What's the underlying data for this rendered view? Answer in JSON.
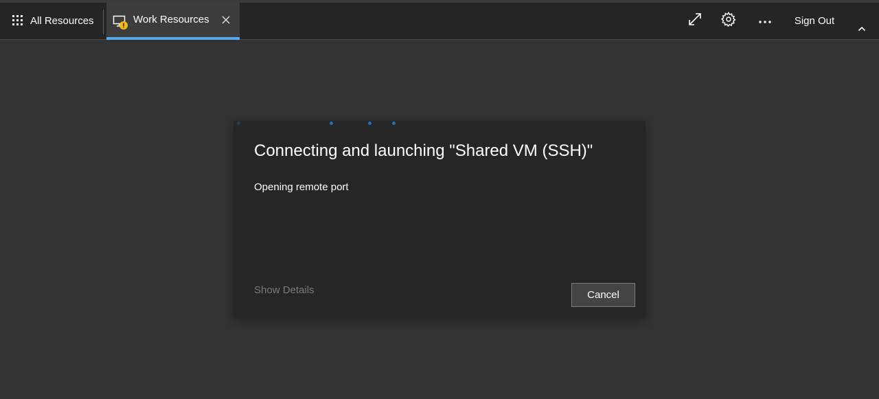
{
  "header": {
    "all_resources_label": "All Resources",
    "all_resources_icon": "apps-grid-icon",
    "tab": {
      "label": "Work Resources",
      "icon": "remote-desktop-warning-icon",
      "badge_icon": "warning-badge-icon",
      "close_icon": "close-icon",
      "accent_color": "#5aa9e6"
    },
    "actions": {
      "fullscreen_icon": "expand-icon",
      "settings_icon": "gear-icon",
      "more_icon": "more-dots-icon",
      "sign_out_label": "Sign Out",
      "collapse_icon": "chevron-up-icon"
    }
  },
  "dialog": {
    "title": "Connecting and launching \"Shared VM (SSH)\"",
    "status": "Opening remote port",
    "show_details_label": "Show Details",
    "cancel_label": "Cancel",
    "progress_indicator": "loading-dots",
    "progress_color": "#1e73be"
  },
  "colors": {
    "background": "#333333",
    "topbar": "#252525",
    "dialog": "#262626",
    "warning": "#f5b90f"
  }
}
